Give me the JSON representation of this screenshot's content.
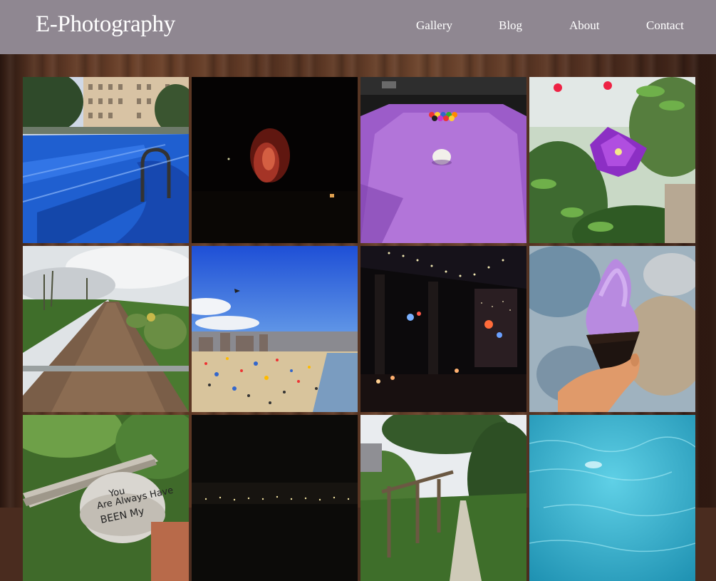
{
  "header": {
    "brand": "E-Photography",
    "nav": [
      {
        "label": "Gallery"
      },
      {
        "label": "Blog"
      },
      {
        "label": "About"
      },
      {
        "label": "Contact"
      }
    ]
  },
  "gallery": {
    "photos": [
      {
        "subject": "swimming-pool"
      },
      {
        "subject": "night-fire"
      },
      {
        "subject": "pool-table"
      },
      {
        "subject": "purple-flower"
      },
      {
        "subject": "dirt-path"
      },
      {
        "subject": "crowded-beach"
      },
      {
        "subject": "night-bar"
      },
      {
        "subject": "ice-cream-cone"
      },
      {
        "subject": "painted-rock",
        "text": "You Are & Always Have BEEN My"
      },
      {
        "subject": "night-skyline"
      },
      {
        "subject": "wooded-trail"
      },
      {
        "subject": "blue-water"
      }
    ]
  },
  "colors": {
    "header_bg": "#8f8791",
    "nav_text": "#ffffff",
    "wood": "#5b3624"
  }
}
